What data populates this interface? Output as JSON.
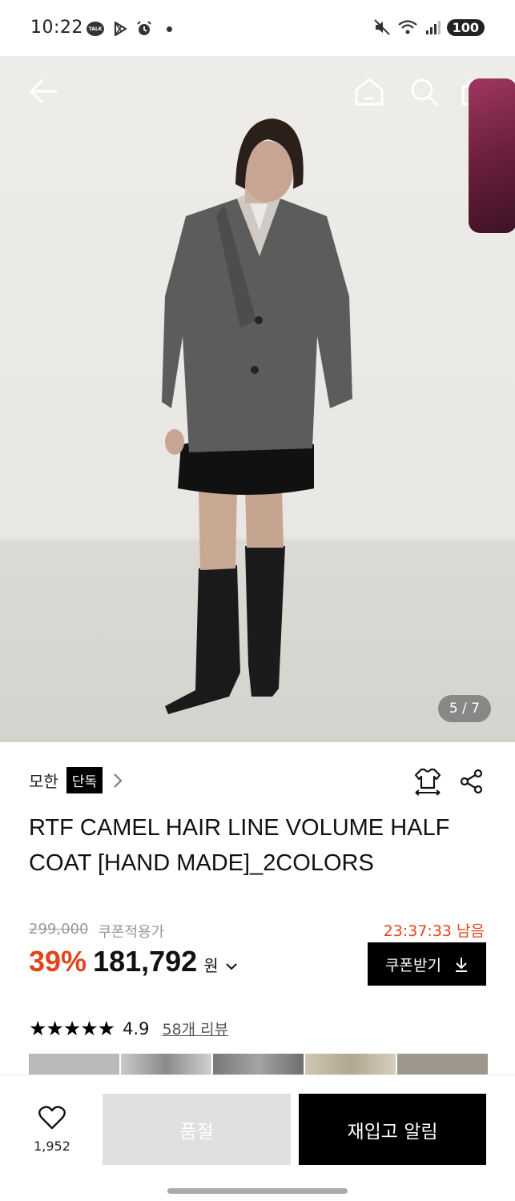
{
  "status_bar": {
    "time": "10:22",
    "talk_badge": "TALK",
    "battery": "100",
    "left_icons": [
      "talk-icon",
      "play-store-icon",
      "alarm-icon"
    ],
    "right_icons": [
      "mute-icon",
      "wifi-icon",
      "signal-icon"
    ]
  },
  "hero": {
    "pager": "5 / 7",
    "nav_icons": [
      "back-arrow-icon",
      "home-icon",
      "search-icon",
      "cart-icon"
    ]
  },
  "product": {
    "brand": "모한",
    "exclusive_badge": "단독",
    "title": "RTF CAMEL HAIR LINE VOLUME HALF COAT [HAND MADE]_2COLORS",
    "original_price": "299,000",
    "coupon_price_label": "쿠폰적용가",
    "timer": "23:37:33 남음",
    "discount": "39%",
    "sale_price": "181,792",
    "currency": "원",
    "coupon_button": "쿠폰받기",
    "stars": "★★★★★",
    "rating": "4.9",
    "reviews": "58개 리뷰"
  },
  "bottom_bar": {
    "like_count": "1,952",
    "soldout_label": "품절",
    "restock_label": "재입고 알림"
  },
  "colors": {
    "accent_orange": "#e2451b",
    "black": "#000000",
    "soldout_gray": "#e0e0e0"
  }
}
